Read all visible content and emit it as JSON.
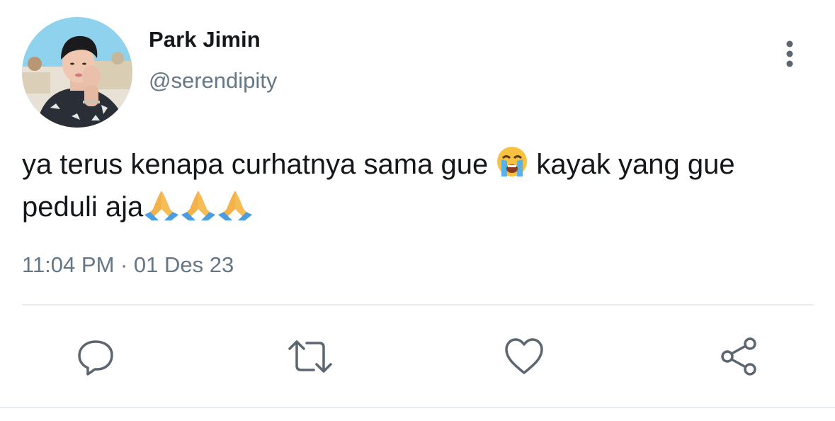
{
  "user": {
    "display_name": "Park Jimin",
    "handle": "@serendipity",
    "avatar_icon": "profile-photo"
  },
  "tweet": {
    "text_part1": "ya terus kenapa curhatnya sama gue ",
    "emoji_crying": "loudly-crying-face-emoji",
    "text_part2": " kayak yang gue peduli aja",
    "emoji_pray": "folded-hands-emoji",
    "emoji_pray_count": 3,
    "timestamp": "11:04 PM · 01 Des 23"
  },
  "actions": {
    "reply_icon": "reply-icon",
    "retweet_icon": "retweet-icon",
    "like_icon": "heart-icon",
    "share_icon": "share-icon",
    "more_icon": "more-vertical-icon"
  },
  "colors": {
    "text": "#14171a",
    "secondary": "#657786",
    "divider": "#e6ecf0"
  }
}
